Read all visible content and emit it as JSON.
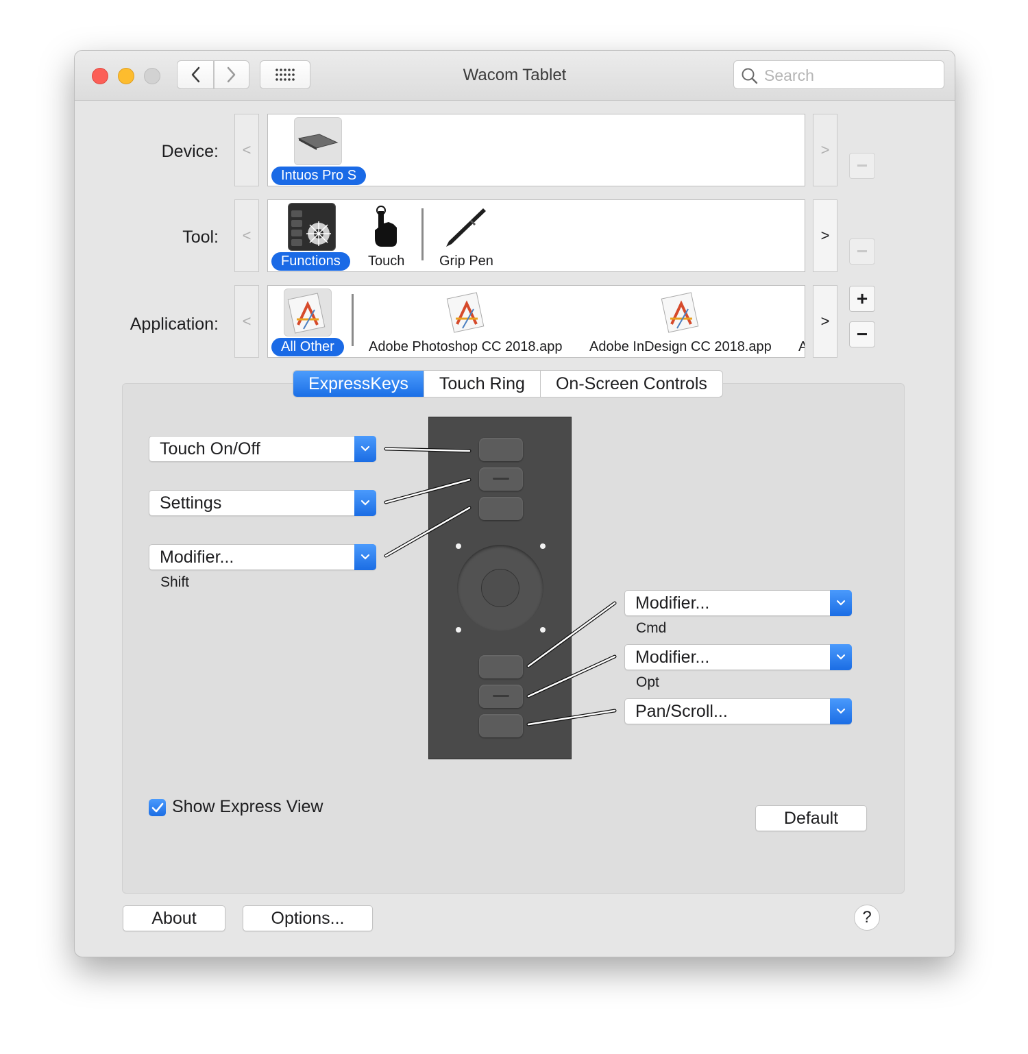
{
  "window": {
    "title": "Wacom Tablet"
  },
  "search": {
    "placeholder": "Search"
  },
  "device": {
    "label": "Device:",
    "items": [
      {
        "name": "Intuos Pro S",
        "selected": true
      }
    ]
  },
  "tool": {
    "label": "Tool:",
    "items": [
      {
        "name": "Functions",
        "selected": true
      },
      {
        "name": "Touch",
        "selected": false
      },
      {
        "name": "Grip Pen",
        "selected": false
      }
    ]
  },
  "application": {
    "label": "Application:",
    "items": [
      {
        "name": "All Other",
        "selected": true
      },
      {
        "name": "Adobe Photoshop CC 2018.app",
        "selected": false
      },
      {
        "name": "Adobe InDesign CC 2018.app",
        "selected": false
      },
      {
        "name": "A",
        "selected": false
      }
    ]
  },
  "controls": {
    "prev": "<",
    "next": ">",
    "add": "+",
    "remove": "−"
  },
  "tabs": [
    {
      "label": "ExpressKeys",
      "active": true
    },
    {
      "label": "Touch Ring",
      "active": false
    },
    {
      "label": "On-Screen Controls",
      "active": false
    }
  ],
  "expresskeys": {
    "left": [
      {
        "value": "Touch On/Off",
        "sub": ""
      },
      {
        "value": "Settings",
        "sub": ""
      },
      {
        "value": "Modifier...",
        "sub": "Shift"
      }
    ],
    "right": [
      {
        "value": "Modifier...",
        "sub": "Cmd"
      },
      {
        "value": "Modifier...",
        "sub": "Opt"
      },
      {
        "value": "Pan/Scroll...",
        "sub": ""
      }
    ]
  },
  "show_express_view": {
    "label": "Show Express View",
    "checked": true
  },
  "buttons": {
    "default": "Default",
    "about": "About",
    "options": "Options...",
    "help": "?"
  },
  "colors": {
    "accent": "#1a6ae6",
    "window_bg": "#e6e6e6",
    "tablet": "#4a4a4a"
  }
}
